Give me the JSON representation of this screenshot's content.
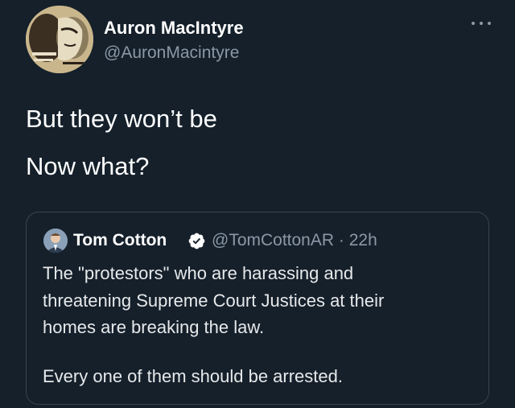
{
  "author": {
    "name": "Auron MacIntyre",
    "handle": "@AuronMacintyre"
  },
  "tweet": {
    "lines": [
      "But they won’t be",
      "Now what?"
    ]
  },
  "quoted": {
    "name": "Tom Cotton",
    "handle": "@TomCottonAR",
    "separator": "·",
    "time": "22h",
    "lines": [
      "The \"protestors\" who are harassing and",
      "threatening Supreme Court Justices at their",
      "homes are breaking the law.",
      "",
      "Every one of them should be arrested."
    ]
  },
  "colors": {
    "background": "#15202b",
    "verified": "#ffffff",
    "muted": "#8b98a5"
  },
  "icons": {
    "more": "more-horizontal-icon",
    "verified": "verified-badge-icon"
  }
}
